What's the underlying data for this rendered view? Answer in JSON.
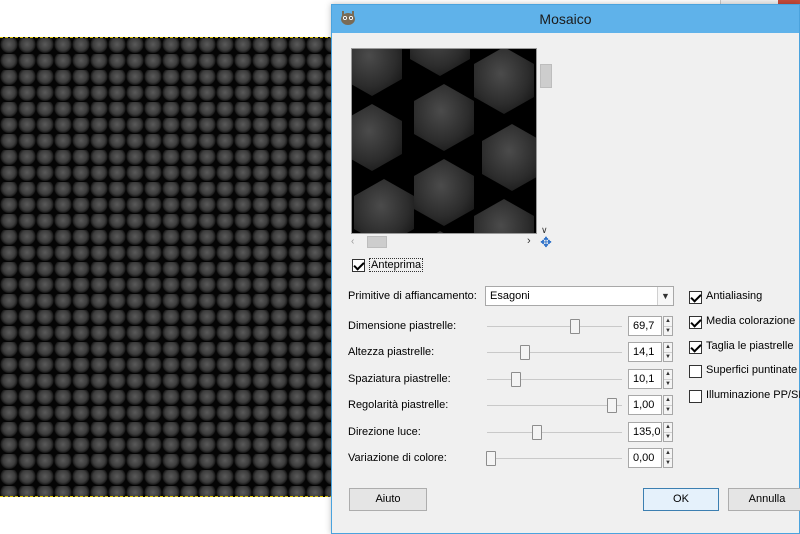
{
  "dialog": {
    "title": "Mosaico",
    "preview": {
      "checkbox_label": "Anteprima",
      "checked": true
    },
    "tiling_primitives": {
      "label": "Primitive di affiancamento:",
      "value": "Esagoni"
    },
    "params": [
      {
        "label": "Dimensione piastrelle:",
        "value": "69,7",
        "level": 0.67
      },
      {
        "label": "Altezza piastrelle:",
        "value": "14,1",
        "level": 0.27
      },
      {
        "label": "Spaziatura piastrelle:",
        "value": "10,1",
        "level": 0.2
      },
      {
        "label": "Regolarità piastrelle:",
        "value": "1,00",
        "level": 0.97
      },
      {
        "label": "Direzione luce:",
        "value": "135,0",
        "level": 0.37
      },
      {
        "label": "Variazione di colore:",
        "value": "0,00",
        "level": 0.0
      }
    ],
    "options": [
      {
        "label": "Antialiasing",
        "checked": true
      },
      {
        "label": "Media colorazione",
        "checked": true
      },
      {
        "label": "Taglia le piastrelle",
        "checked": true
      },
      {
        "label": "Superfici puntinate",
        "checked": false
      },
      {
        "label": "Illuminazione PP/SF",
        "checked": false
      }
    ],
    "buttons": {
      "help": "Aiuto",
      "ok": "OK",
      "cancel": "Annulla"
    }
  },
  "colors": {
    "titlebar": "#5fb2ea",
    "dialog_bg": "#f0f0f0",
    "canvas_dark": "#121212",
    "selection_marquee": "#d8c000"
  }
}
